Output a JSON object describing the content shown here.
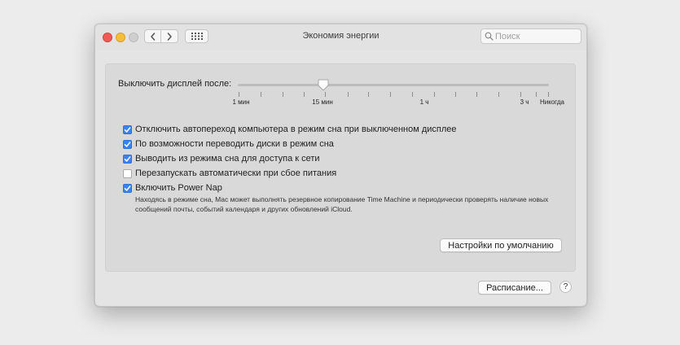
{
  "window": {
    "title": "Экономия энергии"
  },
  "search": {
    "placeholder": "Поиск",
    "value": ""
  },
  "icons": {
    "back": "chevron-left-icon",
    "forward": "chevron-right-icon",
    "grid": "grid-icon",
    "search": "search-icon"
  },
  "display_sleep": {
    "label": "Выключить дисплей после:",
    "selected": "15 мин",
    "ticks": [
      "1 мин",
      "15 мин",
      "1 ч",
      "3 ч",
      "Никогда"
    ]
  },
  "options": [
    {
      "label": "Отключить автопереход компьютера в режим сна при выключенном дисплее",
      "checked": true
    },
    {
      "label": "По возможности переводить диски в режим сна",
      "checked": true
    },
    {
      "label": "Выводить из режима сна для доступа к сети",
      "checked": true
    },
    {
      "label": "Перезапускать автоматически при сбое питания",
      "checked": false
    },
    {
      "label": "Включить Power Nap",
      "checked": true
    }
  ],
  "power_nap_description": "Находясь в режиме сна, Mac может выполнять резервное копирование Time Machine и периодически проверять наличие новых сообщений почты, событий календаря и других обновлений iCloud.",
  "buttons": {
    "defaults": "Настройки по умолчанию",
    "schedule": "Расписание...",
    "help": "?"
  },
  "colors": {
    "accent": "#3a82f6",
    "close": "#ee5c55",
    "minimize": "#f5bd3c",
    "zoom_disabled": "#cfcfcf"
  }
}
